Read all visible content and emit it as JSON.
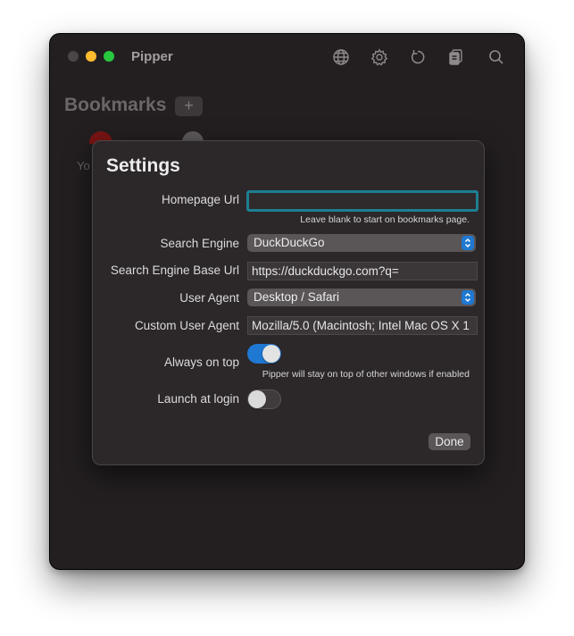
{
  "window": {
    "title": "Pipper",
    "toolbar": {
      "icons": [
        "globe-icon",
        "gear-icon",
        "reload-icon",
        "clipboard-icon",
        "search-icon"
      ]
    }
  },
  "bookmarks": {
    "title": "Bookmarks",
    "add_label": "+",
    "items": [
      {
        "label": "Yo",
        "icon": "youtube-icon"
      },
      {
        "label": "",
        "icon": "bookmark-thumb-icon"
      }
    ]
  },
  "settings": {
    "title": "Settings",
    "homepage": {
      "label": "Homepage Url",
      "value": "",
      "hint": "Leave blank to start on bookmarks page."
    },
    "search_engine": {
      "label": "Search Engine",
      "selected": "DuckDuckGo"
    },
    "search_engine_base_url": {
      "label": "Search Engine Base Url",
      "value": "https://duckduckgo.com?q="
    },
    "user_agent": {
      "label": "User Agent",
      "selected": "Desktop / Safari"
    },
    "custom_user_agent": {
      "label": "Custom User Agent",
      "value": "Mozilla/5.0 (Macintosh; Intel Mac OS X 1"
    },
    "always_on_top": {
      "label": "Always on top",
      "enabled": true,
      "hint": "Pipper will stay on top of other windows if enabled"
    },
    "launch_at_login": {
      "label": "Launch at login",
      "enabled": false
    },
    "done_label": "Done"
  },
  "colors": {
    "accent": "#1f78d1",
    "focus_ring": "#1d7f91",
    "window_bg": "#231f21",
    "sheet_bg": "#2c2729"
  }
}
